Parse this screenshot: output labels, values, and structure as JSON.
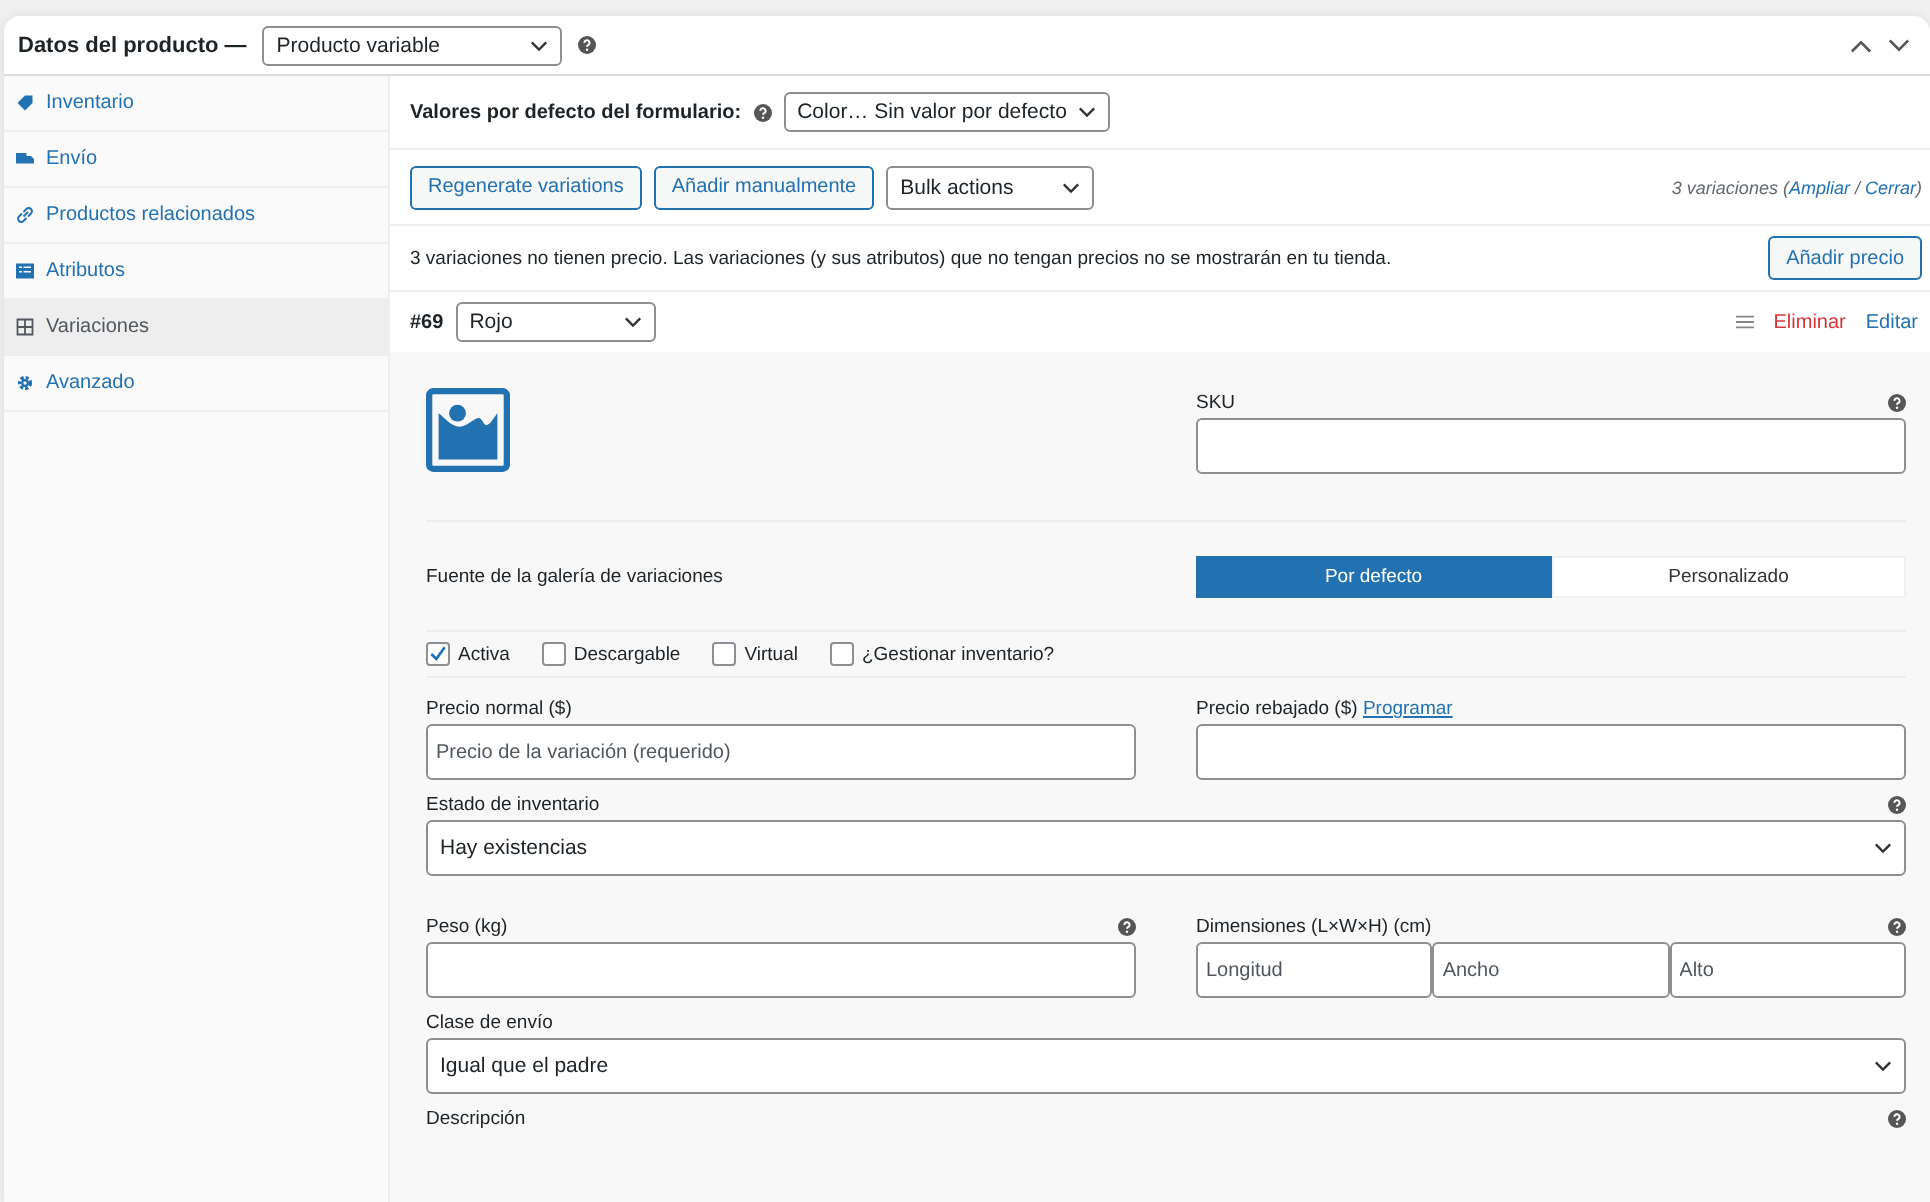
{
  "header": {
    "title": "Datos del producto —",
    "product_type": "Producto variable"
  },
  "sidebar": {
    "items": [
      {
        "label": "Inventario",
        "selected": false
      },
      {
        "label": "Envío",
        "selected": false
      },
      {
        "label": "Productos relacionados",
        "selected": false
      },
      {
        "label": "Atributos",
        "selected": false
      },
      {
        "label": "Variaciones",
        "selected": true
      },
      {
        "label": "Avanzado",
        "selected": false
      }
    ]
  },
  "defaults": {
    "label": "Valores por defecto del formulario:",
    "value": "Color… Sin valor por defecto"
  },
  "toolbar": {
    "buttons": [
      "Regenerate variations",
      "Añadir manualmente"
    ],
    "bulk": "Bulk actions",
    "count": "3 variaciones (",
    "expand": "Ampliar",
    "separator": " / ",
    "collapse": "Cerrar",
    "suffix": ")"
  },
  "notice": {
    "text": "3 variaciones no tienen precio. Las variaciones (y sus atributos) que no tengan precios no se mostrarán en tu tienda.",
    "button": "Añadir precio"
  },
  "variation": {
    "id": "#69",
    "value": "Rojo",
    "delete": "Eliminar",
    "edit": "Editar",
    "sku_label": "SKU",
    "gallery_label": "Fuente de la galería de variaciones",
    "gallery_options": [
      {
        "label": "Por defecto",
        "selected": true
      },
      {
        "label": "Personalizado",
        "selected": false
      }
    ],
    "checkboxes": [
      {
        "label": "Activa",
        "checked": true
      },
      {
        "label": "Descargable",
        "checked": false
      },
      {
        "label": "Virtual",
        "checked": false
      },
      {
        "label": "¿Gestionar inventario?",
        "checked": false
      }
    ],
    "regular_price": {
      "label": "Precio normal ($)",
      "placeholder": "Precio de la variación (requerido)"
    },
    "sale_price": {
      "label": "Precio rebajado ($)",
      "link": "Programar"
    },
    "stock_status": {
      "label": "Estado de inventario",
      "value": "Hay existencias"
    },
    "weight": {
      "label": "Peso (kg)"
    },
    "dimensions": {
      "label": "Dimensiones (L×W×H) (cm)",
      "placeholders": [
        "Longitud",
        "Ancho",
        "Alto"
      ]
    },
    "shipping_class": {
      "label": "Clase de envío",
      "value": "Igual que el padre"
    },
    "description": {
      "label": "Descripción"
    }
  }
}
